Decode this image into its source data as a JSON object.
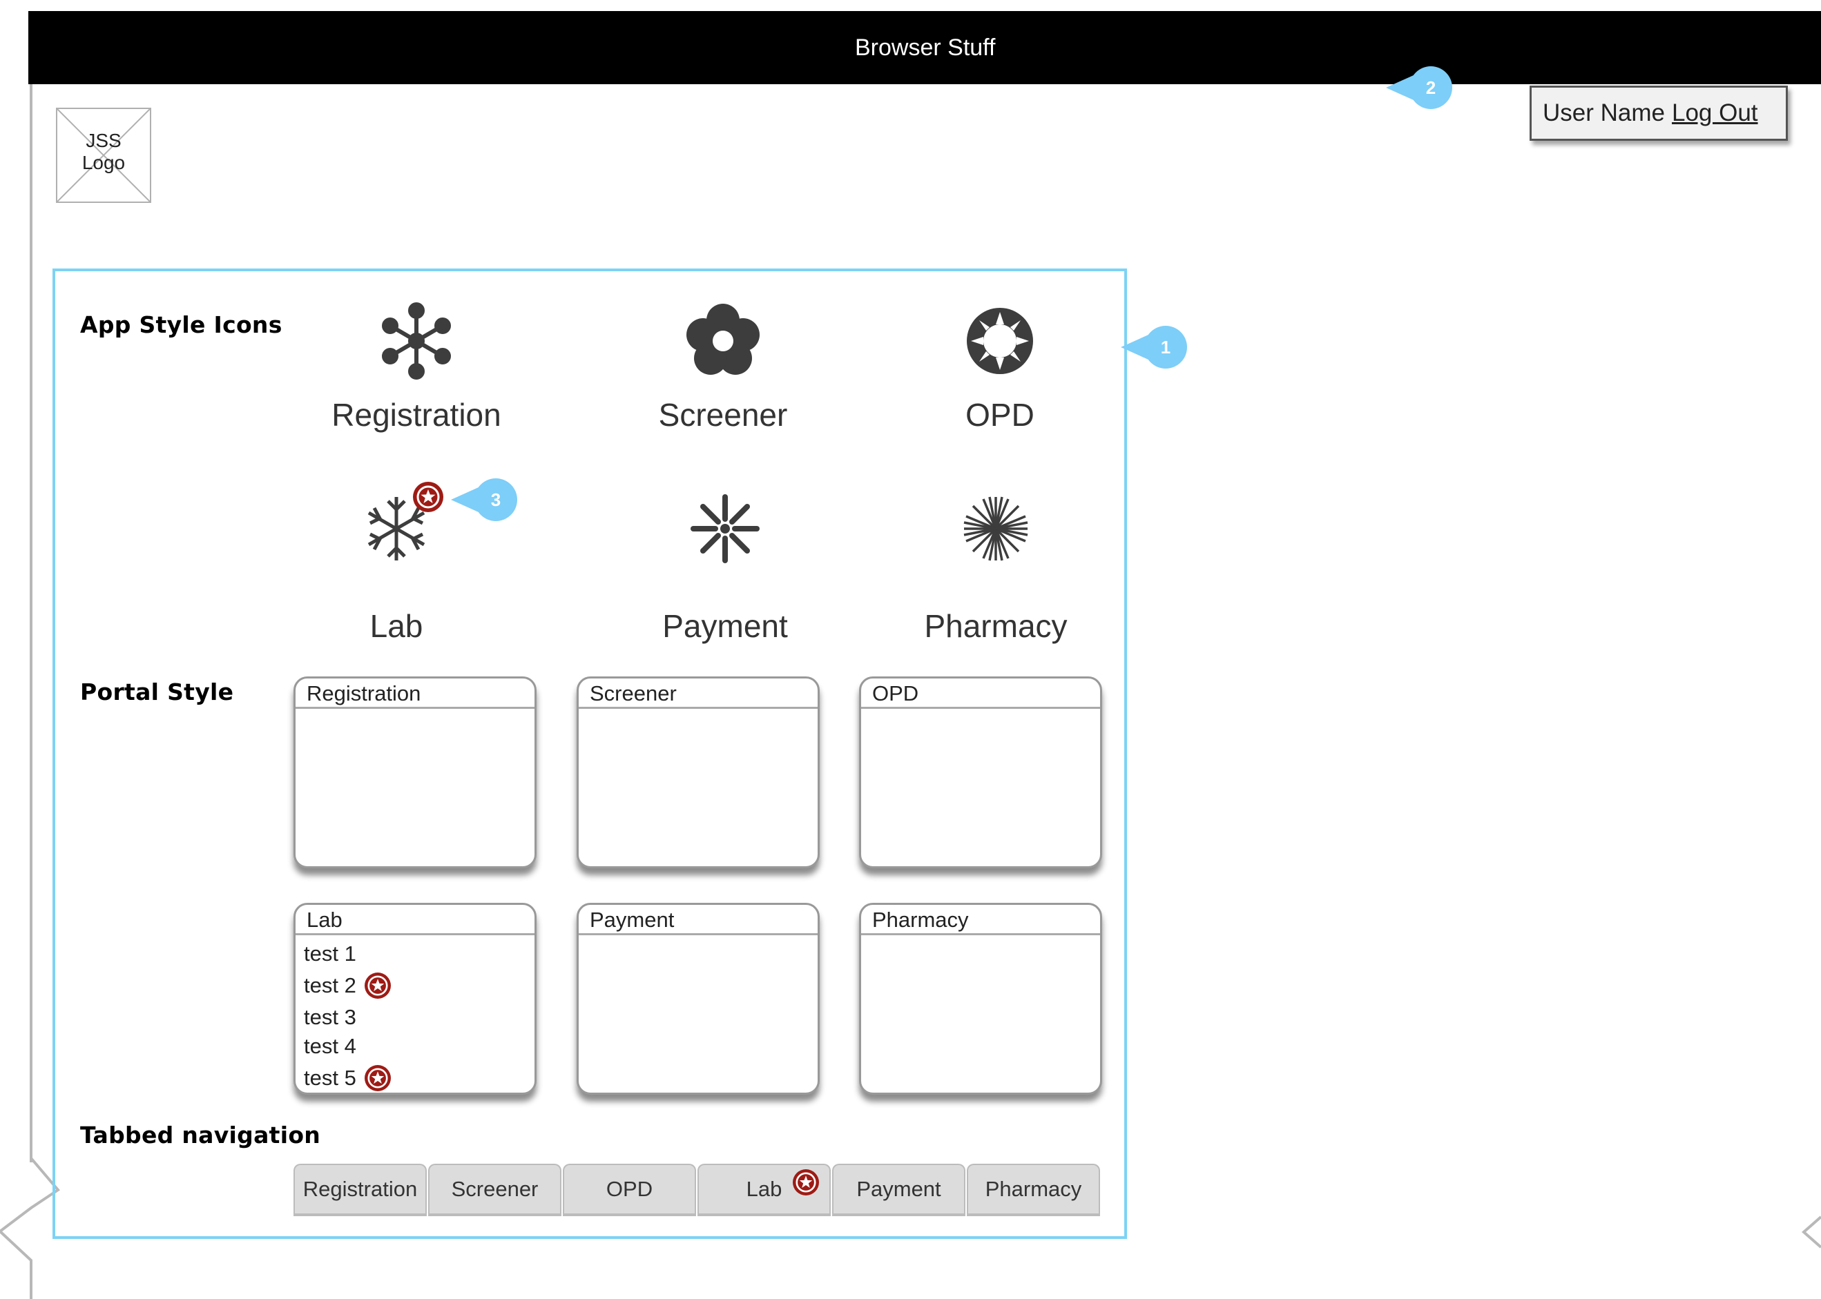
{
  "browser": {
    "title": "Browser Stuff"
  },
  "logo": {
    "text_line1": "JSS",
    "text_line2": "Logo"
  },
  "user": {
    "name": "User Name",
    "logout_label": "Log Out"
  },
  "callouts": {
    "c1": "1",
    "c2": "2",
    "c3": "3"
  },
  "sections": {
    "app_icons": "App Style Icons",
    "portal": "Portal Style",
    "tabbed": "Tabbed navigation"
  },
  "apps": [
    {
      "label": "Registration",
      "icon": "asterisk-nodes-icon"
    },
    {
      "label": "Screener",
      "icon": "flower-icon"
    },
    {
      "label": "OPD",
      "icon": "sun-icon"
    },
    {
      "label": "Lab",
      "icon": "snowflake-icon",
      "badge": true
    },
    {
      "label": "Payment",
      "icon": "burst-icon"
    },
    {
      "label": "Pharmacy",
      "icon": "starburst-icon"
    }
  ],
  "portals": [
    {
      "title": "Registration"
    },
    {
      "title": "Screener"
    },
    {
      "title": "OPD"
    },
    {
      "title": "Lab",
      "items": [
        "test 1",
        "test 2",
        "test 3",
        "test 4",
        "test 5"
      ]
    },
    {
      "title": "Payment"
    },
    {
      "title": "Pharmacy"
    }
  ],
  "tabs": [
    "Registration",
    "Screener",
    "OPD",
    "Lab",
    "Payment",
    "Pharmacy"
  ],
  "colors": {
    "callout": "#7dcef8",
    "frame": "#7dd3f5",
    "badge": "#9e1b15",
    "icon": "#3d3d3d"
  }
}
